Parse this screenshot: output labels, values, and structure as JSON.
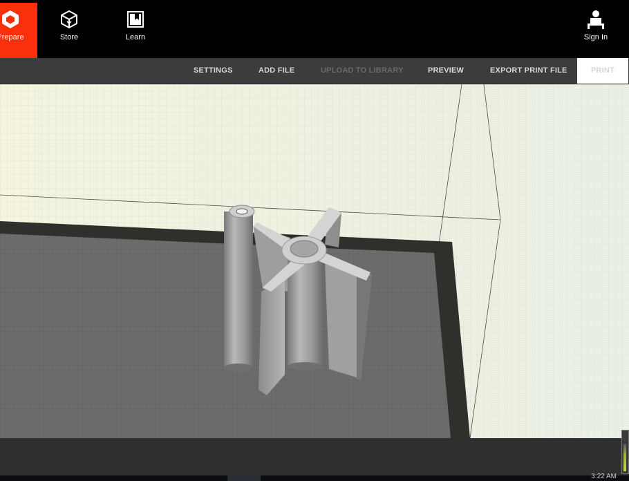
{
  "nav": {
    "prepare": {
      "label": "Prepare",
      "icon": "cube-logo-icon"
    },
    "store": {
      "label": "Store",
      "icon": "store-box-icon"
    },
    "learn": {
      "label": "Learn",
      "icon": "book-icon"
    },
    "signin": {
      "label": "Sign In",
      "icon": "user-icon"
    }
  },
  "toolbar": {
    "settings": "SETTINGS",
    "add_file": "ADD FILE",
    "upload": "UPLOAD TO LIBRARY",
    "preview": "PREVIEW",
    "export": "EXPORT PRINT FILE",
    "print": "PRINT"
  },
  "taskbar": {
    "clock": "3:22 AM"
  },
  "colors": {
    "accent": "#fa2f0c",
    "toolbar_bg": "#3c3c3c",
    "viewport_bg": "#f1f3e4",
    "build_plate": "#6e6e6e",
    "plate_border": "#2f302c",
    "model": "#a9a9a9"
  }
}
